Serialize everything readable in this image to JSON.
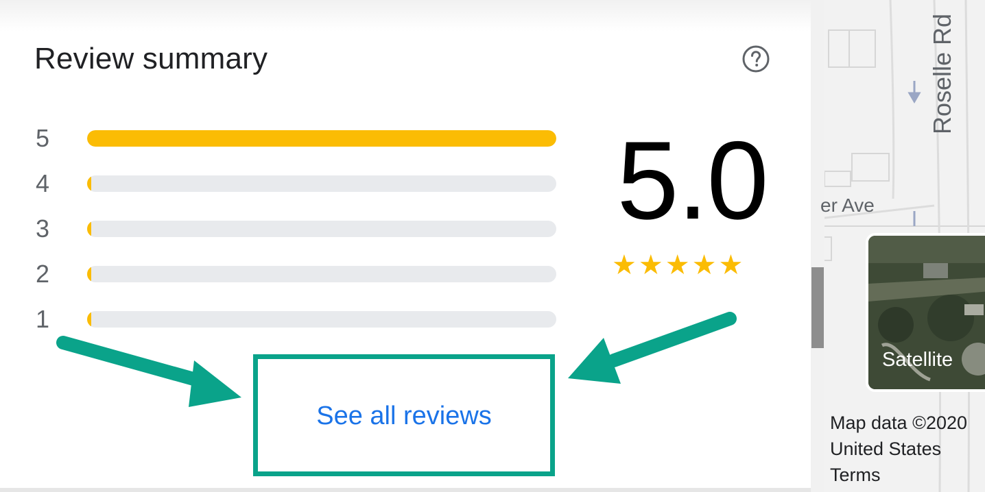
{
  "review_summary": {
    "title": "Review summary",
    "help_icon": "question-circle-icon",
    "rows": [
      {
        "label": "5",
        "fill_fraction": 1.0
      },
      {
        "label": "4",
        "fill_fraction": 0.0
      },
      {
        "label": "3",
        "fill_fraction": 0.0
      },
      {
        "label": "2",
        "fill_fraction": 0.0
      },
      {
        "label": "1",
        "fill_fraction": 0.0
      }
    ],
    "average_rating": "5.0",
    "stars": [
      "★",
      "★",
      "★",
      "★",
      "★"
    ],
    "star_rating_value": 5,
    "see_all_label": "See all reviews"
  },
  "map": {
    "road_vertical": "Roselle Rd",
    "road_horizontal": "er Ave",
    "satellite_label": "Satellite",
    "attribution": [
      "Map data ©2020",
      "United States",
      "Terms"
    ]
  },
  "colors": {
    "bar_fill": "#fbbc04",
    "bar_track": "#e8eaed",
    "link": "#1a73e8",
    "annotation": "#0aa38a"
  }
}
